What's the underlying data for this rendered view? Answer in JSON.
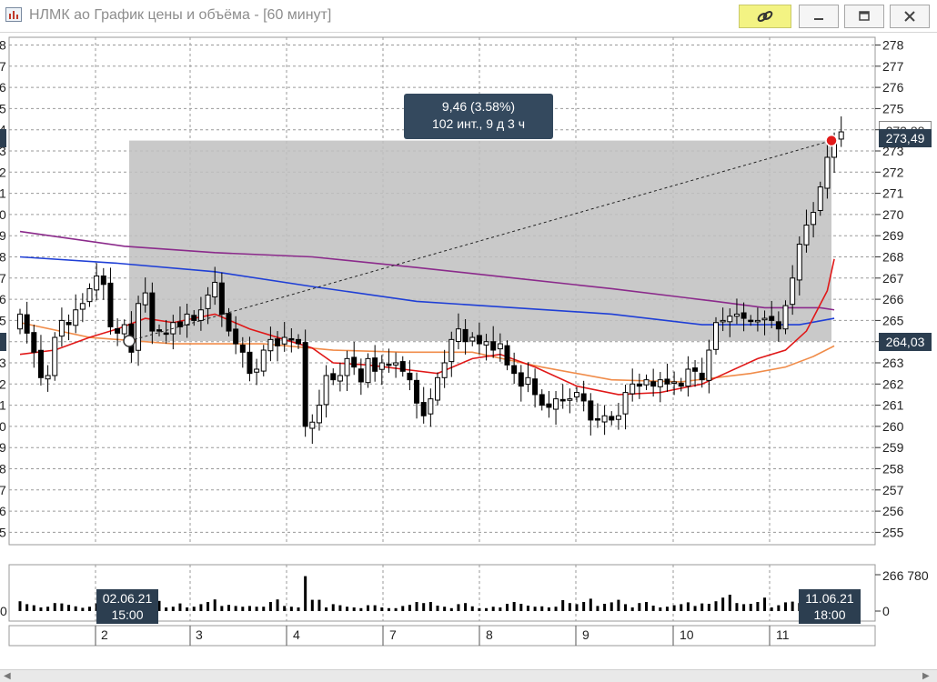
{
  "window": {
    "title": "НЛМК ао График цены и объёма - [60 минут]",
    "buttons": {
      "link_icon": "link-icon",
      "minimize": "minimize-icon",
      "maximize": "maximize-icon",
      "close": "close-icon"
    }
  },
  "price_axis": {
    "ticks": [
      "278",
      "277",
      "276",
      "275",
      "274",
      "273",
      "272",
      "271",
      "270",
      "269",
      "268",
      "267",
      "266",
      "265",
      "264",
      "263",
      "262",
      "261",
      "260",
      "259",
      "258",
      "257",
      "256",
      "255"
    ],
    "left_ticks": [
      "8",
      "7",
      "6",
      "5",
      "4",
      "3",
      "2",
      "1",
      "0",
      "9",
      "8",
      "7",
      "6",
      "5",
      "4",
      "3",
      "2",
      "1",
      "0",
      "9",
      "8",
      "7",
      "6",
      "5"
    ]
  },
  "measurement": {
    "line1": "9,46 (3.58%)",
    "line2": "102 инт., 9 д 3 ч",
    "start_price": "264,03",
    "end_price": "273,49",
    "last_price": "273,88"
  },
  "volume_axis": {
    "max": "266 780",
    "zero": "0",
    "left_zero": "0"
  },
  "date_labels": {
    "start": {
      "date": "02.06.21",
      "time": "15:00"
    },
    "end": {
      "date": "11.06.21",
      "time": "18:00"
    }
  },
  "days": [
    "2",
    "3",
    "4",
    "7",
    "8",
    "9",
    "10",
    "11"
  ],
  "colors": {
    "selection": "#c0c0c0",
    "ma_purple": "#8b2a8b",
    "ma_blue": "#1f3fd6",
    "ma_red": "#e01818",
    "ma_orange": "#f08c4a",
    "label_bg": "#2c3e50"
  },
  "chart_data": {
    "type": "candlestick",
    "timeframe": "60 минут",
    "ylim": [
      255,
      278
    ],
    "last_price": 273.88,
    "measurement": {
      "from": 264.03,
      "to": 273.49,
      "change": 9.46,
      "change_pct": 3.58,
      "bars": 102
    },
    "days": [
      "2",
      "3",
      "4",
      "7",
      "8",
      "9",
      "10",
      "11"
    ],
    "close": [
      265.3,
      264.4,
      263.5,
      262.3,
      262.4,
      264.2,
      265.0,
      264.8,
      265.5,
      265.8,
      266.5,
      267.1,
      266.7,
      264.7,
      264.4,
      264.8,
      263.5,
      265.8,
      266.3,
      264.5,
      264.5,
      264.4,
      264.9,
      264.7,
      265.3,
      265.0,
      265.5,
      266.2,
      266.8,
      265.3,
      264.5,
      263.9,
      263.5,
      262.5,
      262.7,
      263.6,
      264.1,
      263.8,
      264.2,
      264.1,
      263.9,
      260.0,
      260.2,
      261.0,
      262.4,
      262.2,
      262.4,
      263.2,
      262.8,
      262.1,
      263.2,
      262.6,
      263.0,
      262.9,
      263.0,
      262.6,
      262.2,
      261.1,
      260.5,
      261.3,
      262.3,
      263.0,
      264.1,
      264.6,
      264.0,
      264.2,
      263.9,
      264.0,
      263.6,
      263.9,
      262.9,
      262.5,
      261.9,
      262.3,
      261.5,
      261.0,
      260.9,
      261.3,
      261.2,
      261.3,
      261.6,
      261.2,
      260.3,
      260.3,
      260.5,
      260.3,
      260.5,
      261.6,
      262.0,
      261.9,
      262.2,
      261.9,
      262.2,
      262.0,
      262.1,
      261.9,
      262.7,
      262.6,
      262.2,
      263.6,
      264.9,
      265.0,
      265.2,
      265.3,
      265.1,
      265.0,
      265.0,
      265.1,
      265.0,
      264.6,
      265.7,
      267.0,
      268.6,
      269.5,
      270.1,
      271.3,
      272.7,
      273.5,
      273.9
    ],
    "volume": [
      0.27,
      0.19,
      0.16,
      0.1,
      0.12,
      0.22,
      0.21,
      0.17,
      0.13,
      0.09,
      0.12,
      0.21,
      0.24,
      0.19,
      0.32,
      0.24,
      0.08,
      0.09,
      0.13,
      0.22,
      0.28,
      0.1,
      0.12,
      0.21,
      0.1,
      0.12,
      0.19,
      0.25,
      0.32,
      0.14,
      0.17,
      0.14,
      0.12,
      0.14,
      0.12,
      0.12,
      0.25,
      0.32,
      0.14,
      0.12,
      0.1,
      0.96,
      0.31,
      0.31,
      0.1,
      0.19,
      0.16,
      0.12,
      0.1,
      0.08,
      0.16,
      0.16,
      0.1,
      0.08,
      0.08,
      0.14,
      0.17,
      0.25,
      0.22,
      0.25,
      0.15,
      0.12,
      0.08,
      0.19,
      0.22,
      0.13,
      0.08,
      0.08,
      0.12,
      0.1,
      0.2,
      0.25,
      0.2,
      0.15,
      0.12,
      0.13,
      0.1,
      0.12,
      0.3,
      0.22,
      0.19,
      0.25,
      0.34,
      0.14,
      0.2,
      0.24,
      0.31,
      0.19,
      0.1,
      0.22,
      0.25,
      0.15,
      0.1,
      0.12,
      0.16,
      0.19,
      0.24,
      0.14,
      0.21,
      0.2,
      0.27,
      0.37,
      0.45,
      0.22,
      0.19,
      0.2,
      0.25,
      0.37,
      0.1,
      0.16,
      0.24,
      0.26,
      0.22,
      0.1,
      0.19,
      0.3,
      0.2,
      0.25,
      0.6
    ],
    "ma_purple": [
      {
        "x": 0,
        "y": 269.2
      },
      {
        "x": 15,
        "y": 268.5
      },
      {
        "x": 28,
        "y": 268.2
      },
      {
        "x": 42,
        "y": 268.0
      },
      {
        "x": 57,
        "y": 267.5
      },
      {
        "x": 71,
        "y": 267.0
      },
      {
        "x": 85,
        "y": 266.5
      },
      {
        "x": 100,
        "y": 265.9
      },
      {
        "x": 107,
        "y": 265.6
      },
      {
        "x": 115,
        "y": 265.6
      },
      {
        "x": 117,
        "y": 265.5
      }
    ],
    "ma_blue": [
      {
        "x": 0,
        "y": 268.0
      },
      {
        "x": 14,
        "y": 267.7
      },
      {
        "x": 28,
        "y": 267.3
      },
      {
        "x": 42,
        "y": 266.6
      },
      {
        "x": 57,
        "y": 265.9
      },
      {
        "x": 71,
        "y": 265.6
      },
      {
        "x": 85,
        "y": 265.3
      },
      {
        "x": 98,
        "y": 264.8
      },
      {
        "x": 107,
        "y": 264.8
      },
      {
        "x": 112,
        "y": 264.8
      },
      {
        "x": 117,
        "y": 265.1
      }
    ],
    "ma_red": [
      {
        "x": 0,
        "y": 263.4
      },
      {
        "x": 5,
        "y": 263.6
      },
      {
        "x": 10,
        "y": 264.2
      },
      {
        "x": 14,
        "y": 264.6
      },
      {
        "x": 18,
        "y": 265.1
      },
      {
        "x": 22,
        "y": 264.9
      },
      {
        "x": 28,
        "y": 265.3
      },
      {
        "x": 33,
        "y": 264.6
      },
      {
        "x": 39,
        "y": 264.0
      },
      {
        "x": 42,
        "y": 263.7
      },
      {
        "x": 45,
        "y": 263.0
      },
      {
        "x": 50,
        "y": 262.9
      },
      {
        "x": 55,
        "y": 262.7
      },
      {
        "x": 60,
        "y": 262.5
      },
      {
        "x": 65,
        "y": 263.2
      },
      {
        "x": 69,
        "y": 263.4
      },
      {
        "x": 74,
        "y": 262.8
      },
      {
        "x": 80,
        "y": 261.9
      },
      {
        "x": 86,
        "y": 261.5
      },
      {
        "x": 92,
        "y": 261.6
      },
      {
        "x": 98,
        "y": 262.0
      },
      {
        "x": 102,
        "y": 262.6
      },
      {
        "x": 106,
        "y": 263.2
      },
      {
        "x": 110,
        "y": 263.6
      },
      {
        "x": 113,
        "y": 264.5
      },
      {
        "x": 116,
        "y": 266.4
      },
      {
        "x": 117,
        "y": 267.9
      }
    ],
    "ma_orange": [
      {
        "x": 0,
        "y": 264.9
      },
      {
        "x": 10,
        "y": 264.2
      },
      {
        "x": 22,
        "y": 263.9
      },
      {
        "x": 35,
        "y": 263.9
      },
      {
        "x": 45,
        "y": 263.6
      },
      {
        "x": 55,
        "y": 263.5
      },
      {
        "x": 65,
        "y": 263.5
      },
      {
        "x": 75,
        "y": 262.8
      },
      {
        "x": 85,
        "y": 262.2
      },
      {
        "x": 95,
        "y": 262.1
      },
      {
        "x": 105,
        "y": 262.5
      },
      {
        "x": 110,
        "y": 262.8
      },
      {
        "x": 114,
        "y": 263.3
      },
      {
        "x": 117,
        "y": 263.8
      }
    ]
  }
}
